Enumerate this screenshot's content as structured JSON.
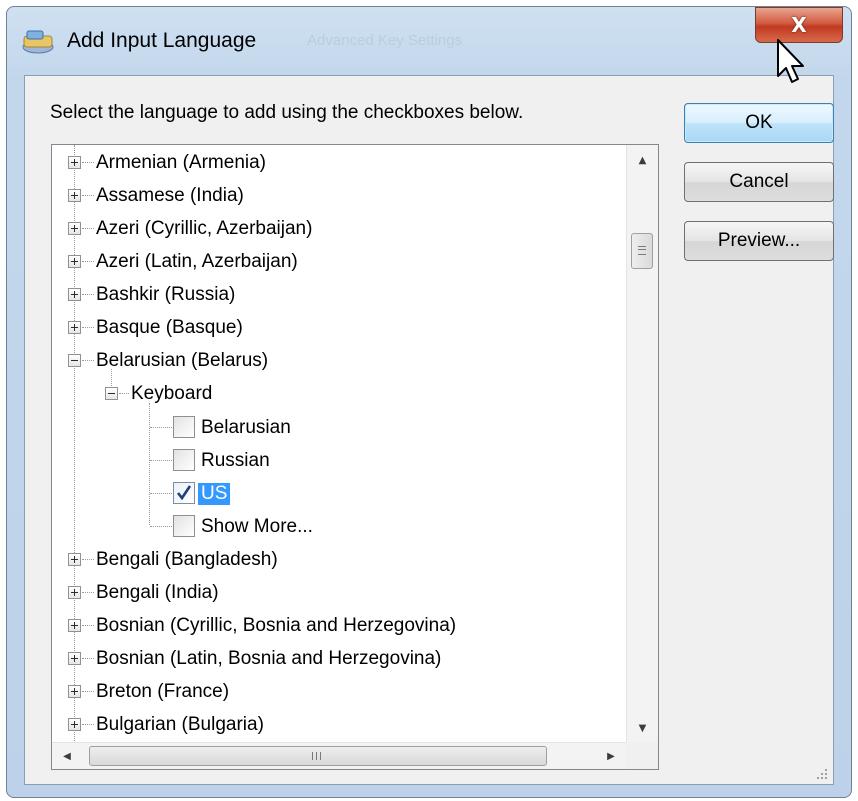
{
  "window": {
    "title": "Add Input Language",
    "behind_title_ghost": "Advanced Key Settings",
    "close_label": "X"
  },
  "instruction": "Select the language to add using the checkboxes below.",
  "buttons": {
    "ok": "OK",
    "cancel": "Cancel",
    "preview": "Preview..."
  },
  "tree": {
    "languages_before": [
      "Armenian (Armenia)",
      "Assamese (India)",
      "Azeri (Cyrillic, Azerbaijan)",
      "Azeri (Latin, Azerbaijan)",
      "Bashkir (Russia)",
      "Basque (Basque)"
    ],
    "expanded_language": "Belarusian (Belarus)",
    "keyboard_node": "Keyboard",
    "keyboards": [
      {
        "label": "Belarusian",
        "checked": false
      },
      {
        "label": "Russian",
        "checked": false
      },
      {
        "label": "US",
        "checked": true,
        "selected": true
      },
      {
        "label": "Show More...",
        "checked": false
      }
    ],
    "languages_after": [
      "Bengali (Bangladesh)",
      "Bengali (India)",
      "Bosnian (Cyrillic, Bosnia and Herzegovina)",
      "Bosnian (Latin, Bosnia and Herzegovina)",
      "Breton (France)",
      "Bulgarian (Bulgaria)"
    ]
  },
  "colors": {
    "selection": "#3399ff",
    "ok_button": "#bfe3f9",
    "close_button": "#c13a20"
  }
}
